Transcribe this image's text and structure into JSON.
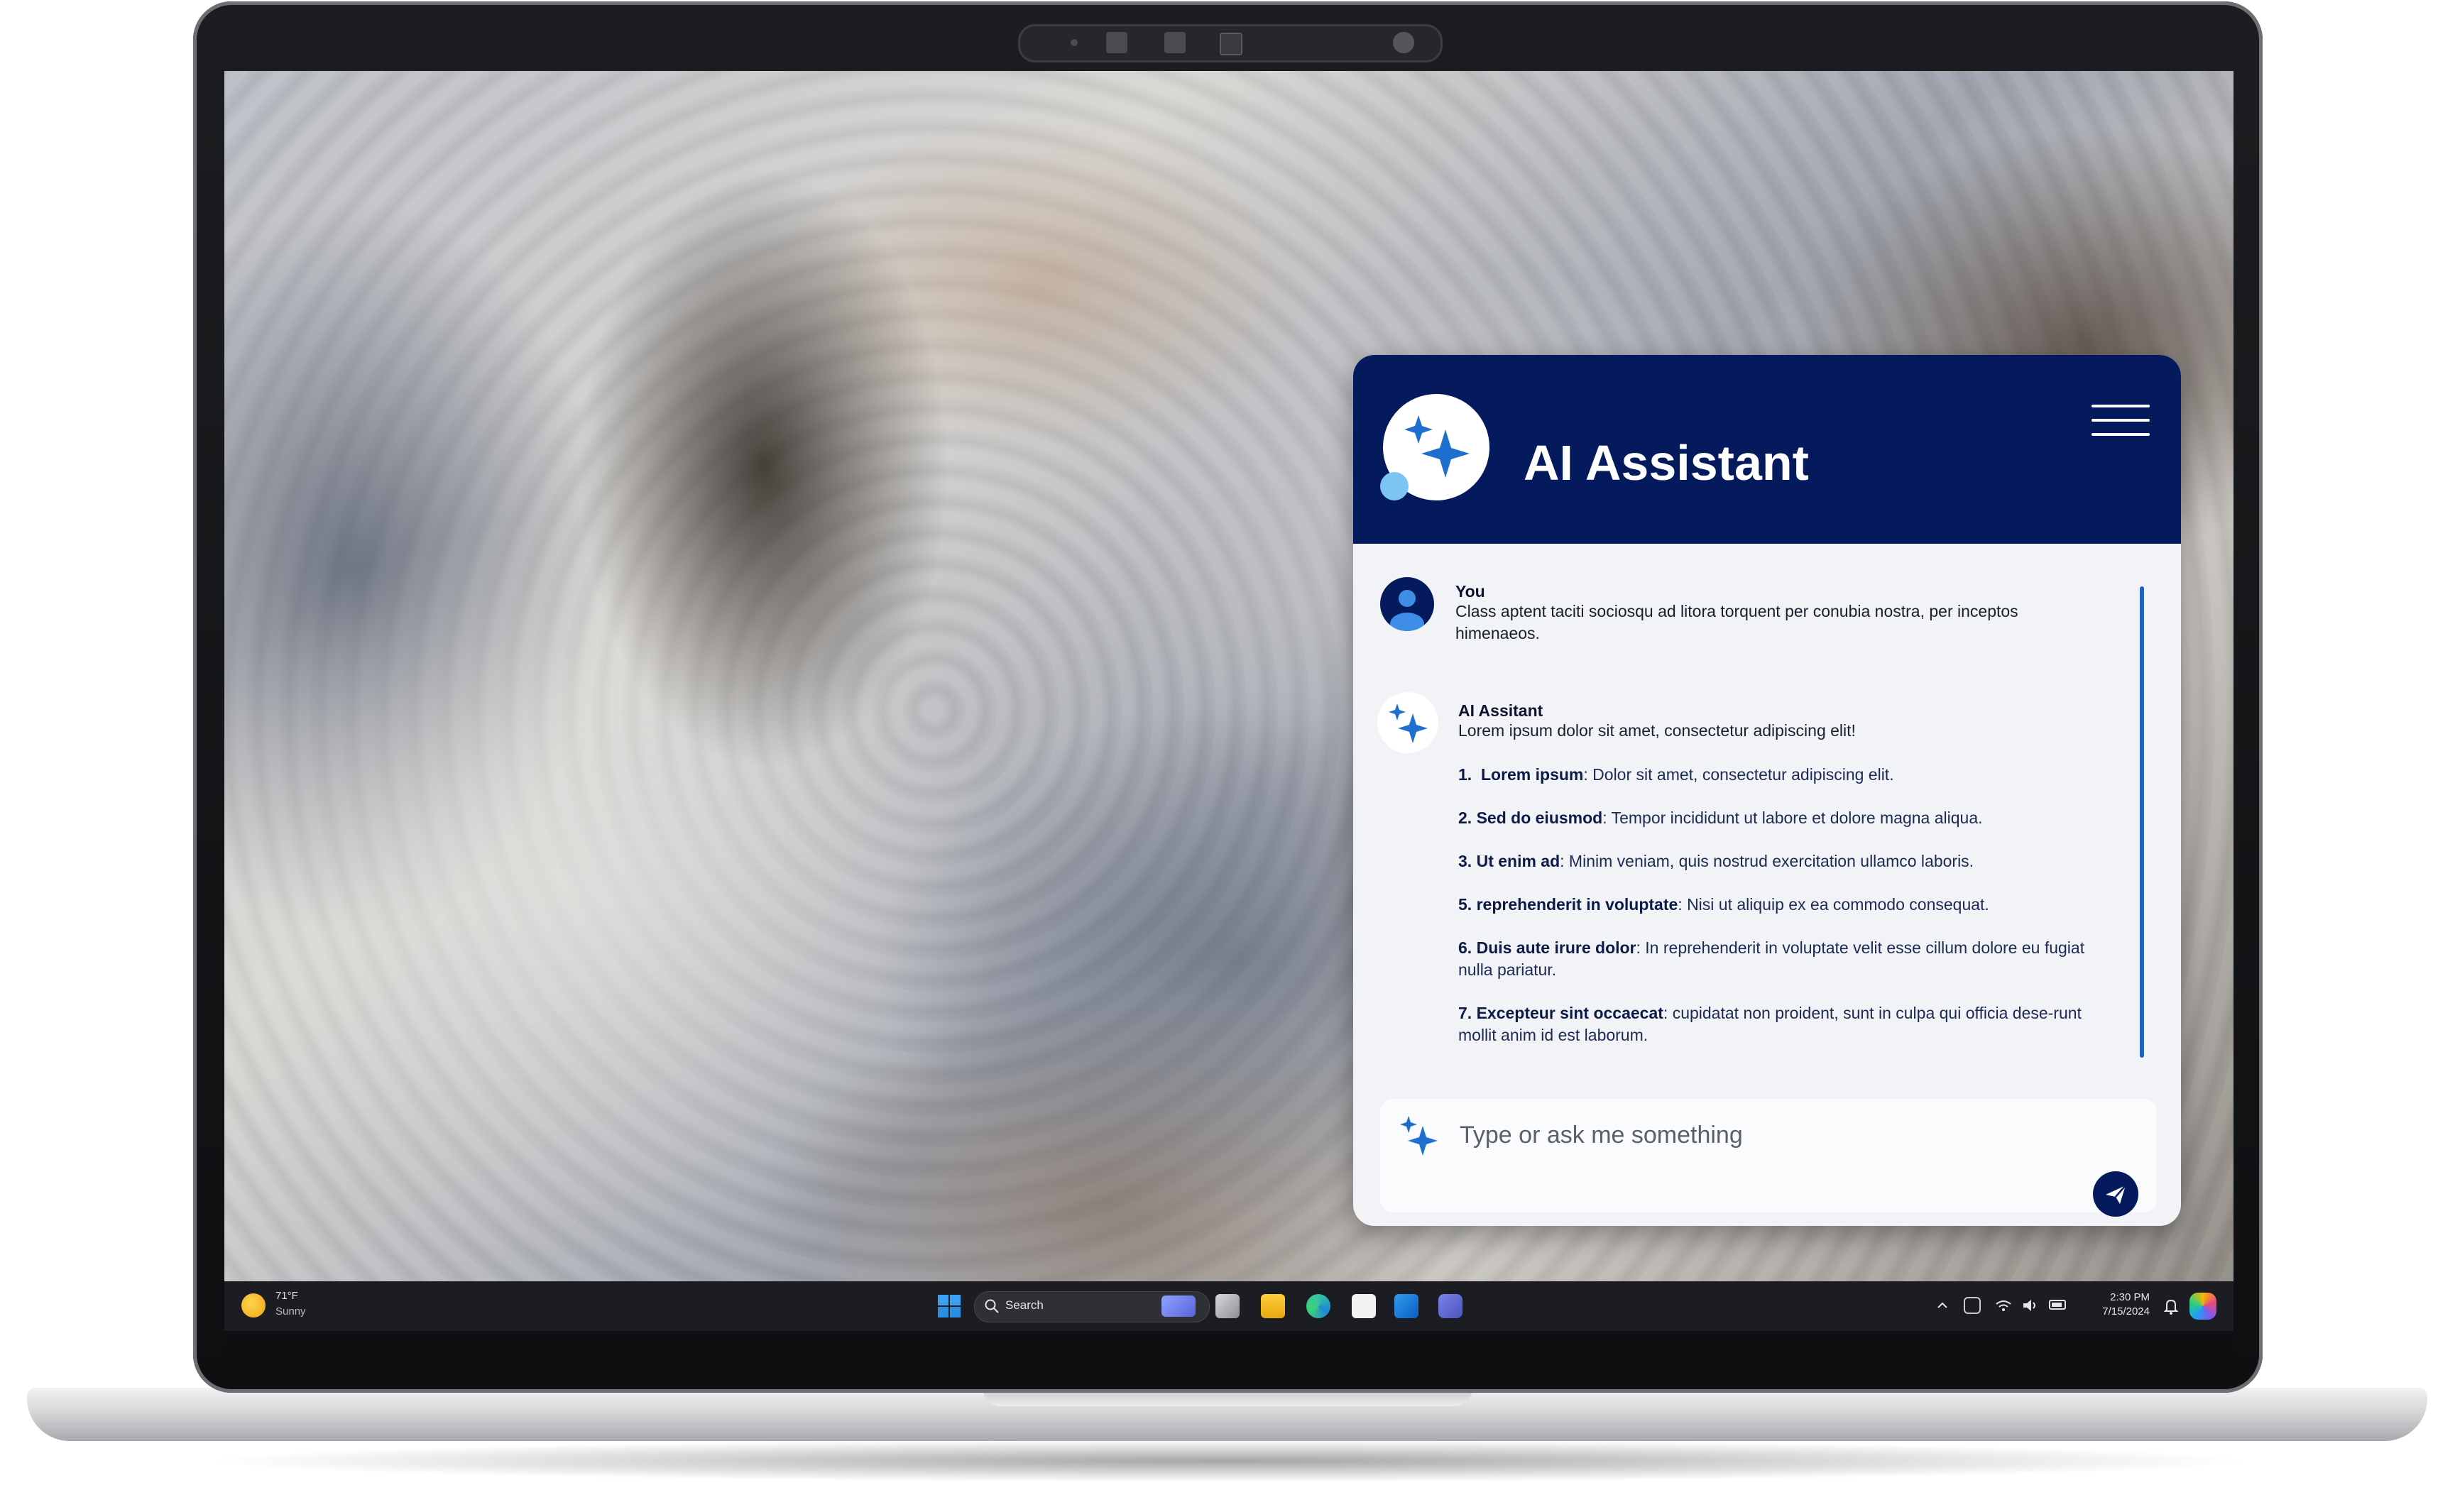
{
  "chat": {
    "title": "AI Assistant",
    "messages": [
      {
        "author": "You",
        "text": "Class aptent taciti sociosqu ad litora torquent per conubia nostra, per inceptos himenaeos."
      },
      {
        "author": "AI Assitant",
        "intro": "Lorem ipsum dolor sit amet, consectetur adipiscing elit!"
      }
    ],
    "list": [
      {
        "num": "1.",
        "title": "Lorem ipsum",
        "text": ": Dolor sit amet, consectetur adipiscing elit."
      },
      {
        "num": "2.",
        "title": "Sed do eiusmod",
        "text": ": Tempor incididunt ut labore et dolore magna aliqua."
      },
      {
        "num": "3.",
        "title": "Ut enim ad",
        "text": ": Minim veniam, quis nostrud exercitation ullamco laboris."
      },
      {
        "num": "5.",
        "title": "reprehenderit in voluptate",
        "text": ": Nisi ut aliquip ex ea commodo consequat."
      },
      {
        "num": "6.",
        "title": "Duis aute irure dolor",
        "text": ": In reprehenderit in voluptate velit esse cillum dolore eu fugiat nulla pariatur."
      },
      {
        "num": "7.",
        "title": "Excepteur sint occaecat",
        "text": ": cupidatat non proident, sunt in culpa qui officia dese-runt mollit anim id est laborum."
      }
    ],
    "input_placeholder": "Type or ask me something"
  },
  "taskbar": {
    "weather_temp": "71°F",
    "weather_desc": "Sunny",
    "search_label": "Search",
    "time": "2:30 PM",
    "date": "7/15/2024"
  },
  "icons": [
    "sparkle-icon",
    "hamburger-menu-icon",
    "user-icon",
    "send-icon",
    "windows-start-icon",
    "search-icon",
    "task-view-icon",
    "file-explorer-icon",
    "edge-icon",
    "store-icon",
    "outlook-icon",
    "teams-icon",
    "chevron-up-icon",
    "wifi-icon",
    "volume-icon",
    "battery-icon",
    "bell-icon",
    "copilot-icon"
  ],
  "colors": {
    "header": "#041a5c",
    "accent": "#1d64c8",
    "sparkle": "#1e6fd0"
  }
}
